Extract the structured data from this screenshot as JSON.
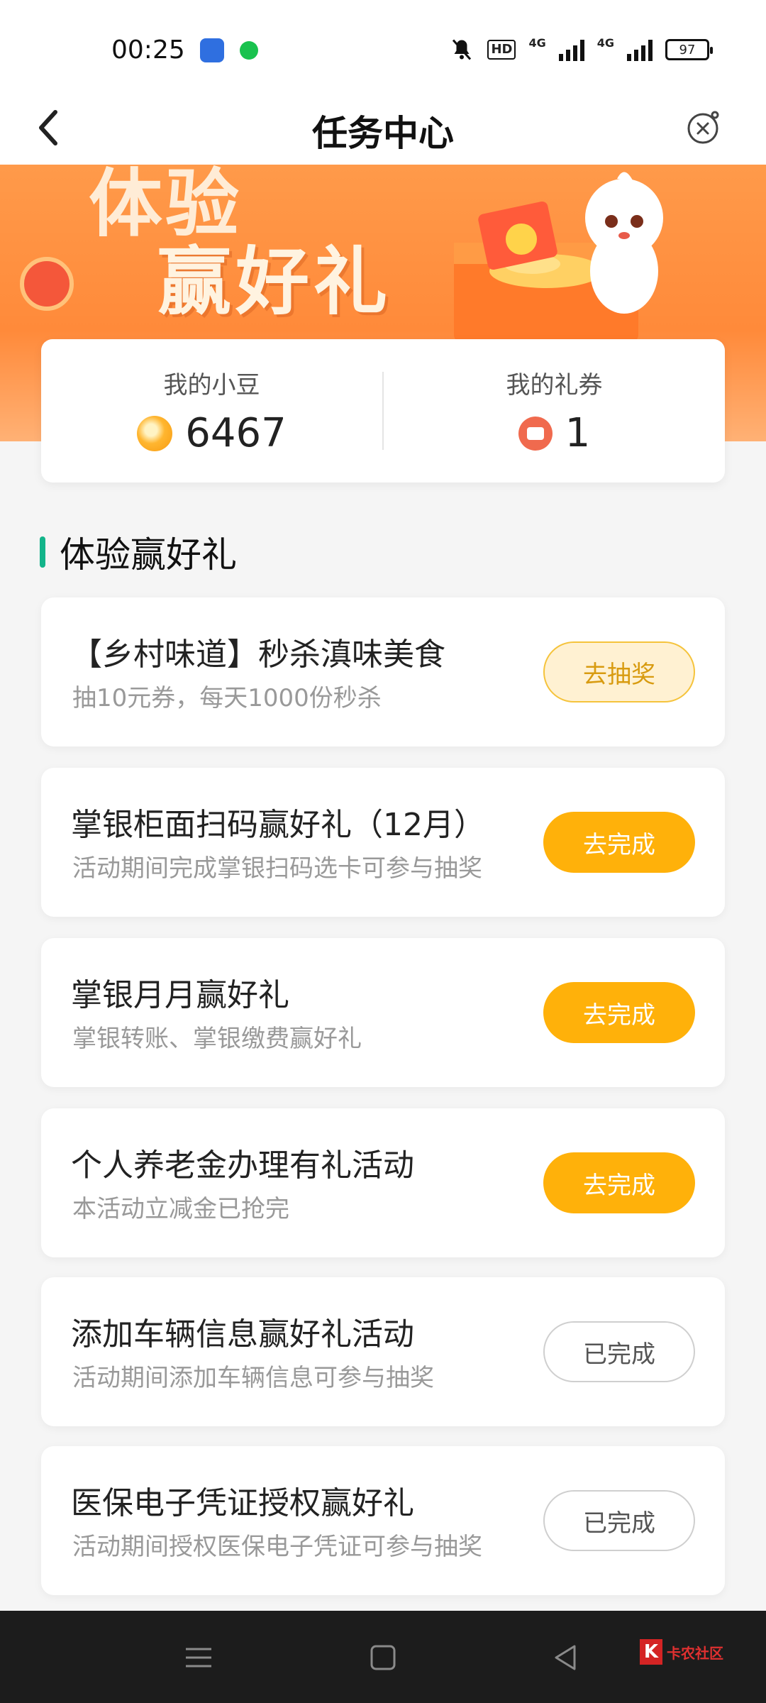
{
  "status_bar": {
    "time": "00:25",
    "hd_label": "HD",
    "net1": "4G",
    "net2": "4G",
    "battery": "97"
  },
  "navbar": {
    "title": "任务中心"
  },
  "banner": {
    "line1": "体验",
    "line2": "赢好礼"
  },
  "stats": {
    "beans_label": "我的小豆",
    "beans_value": "6467",
    "coupons_label": "我的礼券",
    "coupons_value": "1"
  },
  "section": {
    "title": "体验赢好礼"
  },
  "tasks": [
    {
      "title": "【乡村味道】秒杀滇味美食",
      "subtitle": "抽10元券，每天1000份秒杀",
      "button": "去抽奖",
      "state": "lottery"
    },
    {
      "title": "掌银柜面扫码赢好礼（12月）",
      "subtitle": "活动期间完成掌银扫码选卡可参与抽奖",
      "button": "去完成",
      "state": "todo"
    },
    {
      "title": "掌银月月赢好礼",
      "subtitle": "掌银转账、掌银缴费赢好礼",
      "button": "去完成",
      "state": "todo"
    },
    {
      "title": "个人养老金办理有礼活动",
      "subtitle": "本活动立减金已抢完",
      "button": "去完成",
      "state": "todo"
    },
    {
      "title": "添加车辆信息赢好礼活动",
      "subtitle": "活动期间添加车辆信息可参与抽奖",
      "button": "已完成",
      "state": "done"
    },
    {
      "title": "医保电子凭证授权赢好礼",
      "subtitle": "活动期间授权医保电子凭证可参与抽奖",
      "button": "已完成",
      "state": "done"
    }
  ],
  "watermark": {
    "text": "卡农社区"
  },
  "colors": {
    "accent_green": "#13b48a",
    "button_orange": "#ffb10a",
    "banner_orange": "#ff8a3a"
  }
}
